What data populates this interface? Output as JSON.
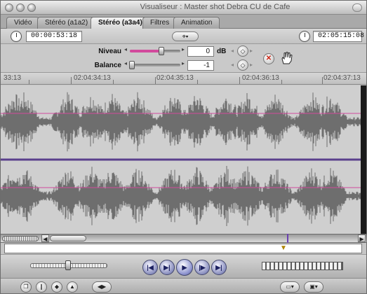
{
  "window": {
    "title": "Visualiseur : Master shot Debra CU de Cafe"
  },
  "tabs": [
    {
      "label": "Vidéo"
    },
    {
      "label": "Stéréo (a1a2)"
    },
    {
      "label": "Stéréo (a3a4)",
      "active": true
    },
    {
      "label": "Filtres"
    },
    {
      "label": "Animation"
    }
  ],
  "timecode": {
    "duration": "00:00:53:18",
    "current": "02:05:15:08",
    "popup_icon": "crosshair-icon"
  },
  "controls": {
    "level": {
      "label": "Niveau",
      "value": "0",
      "unit": "dB",
      "slider_position": 0.62
    },
    "balance": {
      "label": "Balance",
      "value": "-1",
      "slider_position": 0.02
    }
  },
  "ruler": {
    "labels": [
      "33:13",
      "02:04:34:13",
      "02:04:35:13",
      "02:04:36:13",
      "02:04:37:13"
    ]
  },
  "colors": {
    "waveform": "#6e6e6e",
    "level_line": "#d24a9c",
    "channel_divider": "#5a3f8c",
    "playhead": "#6a3fb0"
  },
  "transport": {
    "buttons": [
      "go-to-in-icon",
      "play-in-to-out-icon",
      "play-icon",
      "play-around-icon",
      "go-to-out-icon"
    ]
  }
}
